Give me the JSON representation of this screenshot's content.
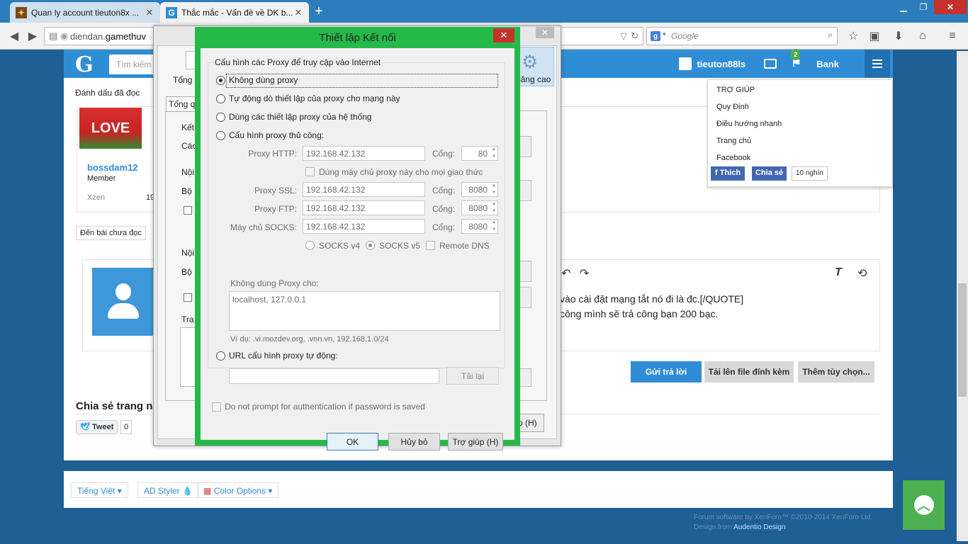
{
  "browser": {
    "tabs": [
      {
        "title": "Quan ly account tieuton8x ..."
      },
      {
        "title": "Thắc mắc - Vấn đề về DK b..."
      }
    ],
    "url_prefix": "diendan.",
    "url_domain": "gamethuv",
    "search_placeholder": "Google",
    "new_tab": "+"
  },
  "site": {
    "logo": "G",
    "search_placeholder": "Tìm kiếm",
    "username": "tieuton88ls",
    "notif_count": "2",
    "bank": "Bank",
    "subnav_mark_read": "Đánh dấu đã đọc",
    "poster": {
      "name": "bossdam12",
      "role": "Member",
      "xzen_label": "Xzen",
      "xzen_value": "19"
    },
    "love_text": "LOVE",
    "unread_button": "Đến bài chưa đọc",
    "editor_lines": [
      "vào cài đặt mạng tắt nó đi là đc.[/QUOTE]",
      "công mình sẽ trả công bạn 200 bạc."
    ],
    "editor_underlined": "đc",
    "buttons": {
      "reply": "Gửi trả lời",
      "upload": "Tải lên file đính kèm",
      "more": "Thêm tùy chọn..."
    },
    "share_title": "Chia sẻ trang nà",
    "tweet": "Tweet",
    "tweet_count": "0",
    "dropdown": {
      "items": [
        "TRỢ GIÚP",
        "Quy Định",
        "Điều hướng nhanh",
        "Trang chủ",
        "Facebook"
      ],
      "fb_like": "Thích",
      "fb_share": "Chia sẻ",
      "fb_count": "10 nghìn"
    },
    "footer": {
      "language": "Tiếng Việt",
      "styler": "AD Styler",
      "color_options": "Color Options",
      "copyright": "Forum software by XenForo™ ©2010-2014 XenForo Ltd.",
      "design_prefix": "Design from",
      "design_link": "Audentio Design"
    }
  },
  "options_dialog": {
    "tab_general": "Tổng",
    "tab_advanced": "ăng cao",
    "tab_button": "Tổng q",
    "labels": [
      "Kết",
      "Các",
      "Nội",
      "Bộ",
      "Nội",
      "Bộ",
      "Tra"
    ],
    "help": "p (H)"
  },
  "dialog": {
    "title": "Thiết lập Kết nối",
    "legend": "Cấu hình các Proxy để truy cập vào Internet",
    "options": {
      "no_proxy": "Không dùng proxy",
      "auto_detect": "Tự động dò thiết lập của proxy cho mạng này",
      "system": "Dùng các thiết lập proxy của hệ thống",
      "manual": "Cấu hình proxy thủ công:",
      "auto_url": "URL cấu hình proxy tự động:"
    },
    "selected": "no_proxy",
    "proxies": [
      {
        "label": "Proxy HTTP:",
        "host": "192.168.42.132",
        "port_label": "Cổng:",
        "port": "80"
      },
      {
        "label": "Proxy SSL:",
        "host": "192.168.42.132",
        "port_label": "Cổng:",
        "port": "8080"
      },
      {
        "label": "Proxy FTP:",
        "host": "192.168.42.132",
        "port_label": "Cổng:",
        "port": "8080"
      },
      {
        "label": "Máy chủ SOCKS:",
        "host": "192.168.42.132",
        "port_label": "Cổng:",
        "port": "8080"
      }
    ],
    "same_proxy": "Dùng máy chủ proxy này cho mọi giao thức",
    "socks_v4": "SOCKS v4",
    "socks_v5": "SOCKS v5",
    "socks_version": "v5",
    "remote_dns": "Remote DNS",
    "no_proxy_for_label": "Không dùng Proxy cho:",
    "no_proxy_for_value": "localhost, 127.0.0.1",
    "example": "Ví dụ: .vi.mozdev.org, .vnn.vn, 192.168.1.0/24",
    "reload": "Tải lại",
    "auth_prompt": "Do not prompt for authentication if password is saved",
    "ok": "OK",
    "cancel": "Hủy bỏ",
    "help": "Trợ giúp (H)"
  },
  "colors": {
    "accent": "#2f8dd6",
    "dialog_frame": "#25b94a",
    "close_red": "#c7312b"
  }
}
